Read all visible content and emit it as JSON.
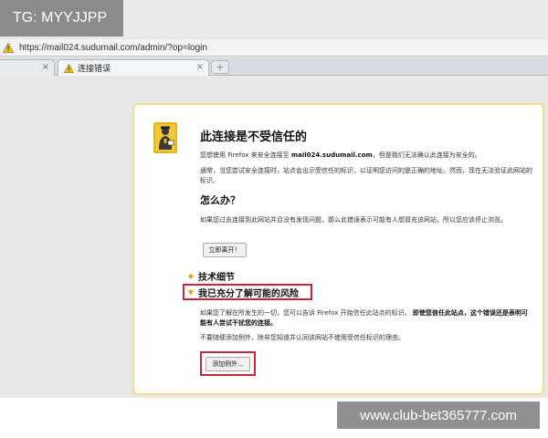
{
  "overlay": {
    "tg_label": "TG: MYYJJPP",
    "site_label": "www.club-bet365777.com"
  },
  "browser": {
    "address_url": "https://mail024.sudumail.com/admin/?op=login",
    "tabs": [
      {
        "label": "",
        "active": false
      },
      {
        "label": "连接错误",
        "active": true
      }
    ],
    "new_tab_label": "+"
  },
  "error_page": {
    "title": "此连接是不受信任的",
    "intro_before": "您想使用 Firefox 来安全连接至 ",
    "intro_domain": "mail024.sudumail.com",
    "intro_after": "，但是我们无法确认此连接为安全的。",
    "explanation": "通常，当您尝试安全连接时，站点会出示受信任的标识，以证明您访问的是正确的地址。然而，现在无法验证此网站的标识。",
    "what_heading": "怎么办？",
    "what_text": "如果您过去连接到此网站并且没有发现问题，那么此错误表示可能有人想冒充该网站，所以您应该停止浏览。",
    "leave_button": "立即离开！",
    "technical_details": "技术细节",
    "understand_risks": "我已充分了解可能的风险",
    "risk_text_before": "如果您了解在所发生的一切，您可以告诉 Firefox 开始信任此站点的标识。",
    "risk_text_bold": "即使您信任此站点，这个错误还是表明可能有人尝试干扰您的连接。",
    "risk_text_2": "不要随便添加例外，除非您知道并认同该网站不使用受信任标识的理由。",
    "add_exception_button": "添加例外..."
  },
  "colors": {
    "dialog_border": "#f3dd85",
    "highlight_box": "#c5283d",
    "section_marker": "#e0a020"
  }
}
